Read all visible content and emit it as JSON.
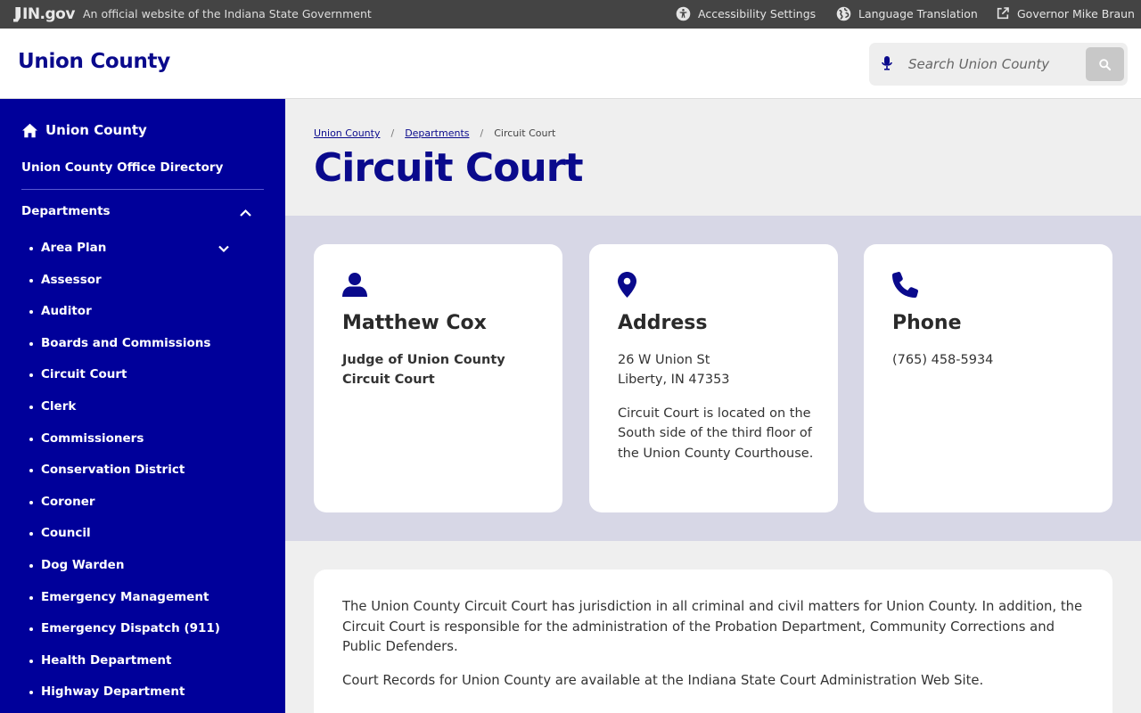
{
  "topbar": {
    "logo_text": "IN.gov",
    "official_text": "An official website of the Indiana State Government",
    "accessibility_label": "Accessibility Settings",
    "language_label": "Language Translation",
    "governor_label": "Governor Mike Braun"
  },
  "header": {
    "site_title": "Union County",
    "search_placeholder": "Search Union County"
  },
  "sidebar": {
    "home_label": "Union County",
    "directory_label": "Union County Office Directory",
    "departments_label": "Departments",
    "items": [
      {
        "label": "Area Plan",
        "expandable": true
      },
      {
        "label": "Assessor"
      },
      {
        "label": "Auditor"
      },
      {
        "label": "Boards and Commissions"
      },
      {
        "label": "Circuit Court",
        "active": true
      },
      {
        "label": "Clerk"
      },
      {
        "label": "Commissioners"
      },
      {
        "label": "Conservation District"
      },
      {
        "label": "Coroner"
      },
      {
        "label": "Council"
      },
      {
        "label": "Dog Warden"
      },
      {
        "label": "Emergency Management"
      },
      {
        "label": "Emergency Dispatch (911)"
      },
      {
        "label": "Health Department"
      },
      {
        "label": "Highway Department"
      }
    ]
  },
  "breadcrumb": {
    "items": [
      "Union County",
      "Departments",
      "Circuit Court"
    ],
    "separator": "/"
  },
  "page_title": "Circuit Court",
  "cards": {
    "person": {
      "icon": "person-icon",
      "title": "Matthew Cox",
      "subtitle_line1": "Judge of Union County",
      "subtitle_line2": "Circuit Court"
    },
    "address": {
      "icon": "map-pin-icon",
      "title": "Address",
      "line1": "26 W Union St",
      "line2": "Liberty, IN 47353",
      "note": "Circuit Court is located on the South side of the third floor of the Union County Courthouse."
    },
    "phone": {
      "icon": "phone-icon",
      "title": "Phone",
      "number": "(765) 458-5934"
    }
  },
  "content": {
    "paragraph1": "The Union County Circuit Court has jurisdiction in all criminal and civil matters for Union County. In addition, the Circuit Court is responsible for the administration of the Probation Department, Community Corrections and Public Defenders.",
    "paragraph2": "Court Records for Union County are available at the Indiana State Court Administration Web Site."
  },
  "colors": {
    "brand_navy": "#0a0a8c",
    "sidebar_blue": "#00009a",
    "topbar_gray": "#444444",
    "card_band": "#d7d7e6"
  }
}
